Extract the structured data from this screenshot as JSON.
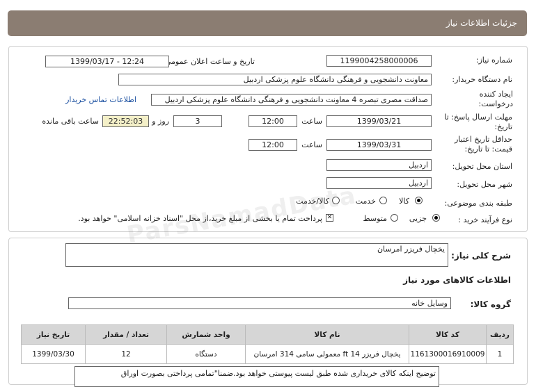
{
  "header": {
    "title": "جزئیات اطلاعات نیاز"
  },
  "form": {
    "need_number_label": "شماره نیاز:",
    "need_number": "1199004258000006",
    "announce_label": "تاریخ و ساعت اعلان عمومی:",
    "announce_value": "1399/03/17 - 12:24",
    "buyer_label": "نام دستگاه خریدار:",
    "buyer_value": "معاونت دانشجویی و فرهنگی دانشگاه علوم پزشکی اردبیل",
    "creator_label": "ایجاد کننده درخواست:",
    "creator_value": "صداقت مصری تبصره 4 معاونت دانشجویی و فرهنگی دانشگاه علوم پزشکی اردبیل",
    "contact_link": "اطلاعات تماس خریدار",
    "deadline_label": "مهلت ارسال پاسخ: تا تاریخ:",
    "deadline_date": "1399/03/21",
    "time_label": "ساعت",
    "deadline_time": "12:00",
    "days_value": "3",
    "days_label": "روز و",
    "remaining_time": "22:52:03",
    "remaining_label": "ساعت باقی مانده",
    "validity_label": "حداقل تاریخ اعتبار قیمت: تا تاریخ:",
    "validity_date": "1399/03/31",
    "validity_time": "12:00",
    "province_label": "استان محل تحویل:",
    "province_value": "اردبیل",
    "city_label": "شهر محل تحویل:",
    "city_value": "اردبیل",
    "category_label": "طبقه بندی موضوعی:",
    "category_options": [
      "کالا",
      "خدمت",
      "کالا/خدمت"
    ],
    "purchase_label": "نوع فرآیند خرید :",
    "purchase_options": [
      "جزیی",
      "متوسط"
    ],
    "payment_note": "پرداخت تمام یا بخشی از مبلغ خرید،از محل \"اسناد خزانه اسلامی\" خواهد بود."
  },
  "summary": {
    "label": "شرح کلی نیاز:",
    "value": "یخچال فریزر امرسان"
  },
  "goods": {
    "section_title": "اطلاعات کالاهای مورد نیاز",
    "group_label": "گروه کالا:",
    "group_value": "وسایل خانه",
    "columns": [
      "ردیف",
      "کد کالا",
      "نام کالا",
      "واحد شمارش",
      "تعداد / مقدار",
      "تاریخ نیاز"
    ],
    "rows": [
      [
        "1",
        "1161300016910009",
        "یخچال فریزر 14 ft معمولی سامی 314 امرسان",
        "دستگاه",
        "12",
        "1399/03/30"
      ]
    ]
  },
  "description": "توضیح اینکه کالای خریداری شده طبق لیست پیوستی خواهد بود.ضمنا\"تمامی پرداختی بصورت اوراق",
  "watermark": "ParsNamadData"
}
